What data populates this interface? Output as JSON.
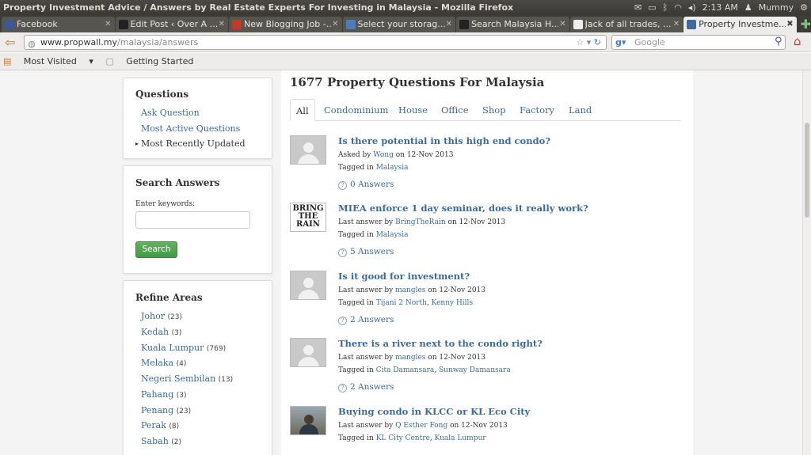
{
  "window_title": "Property Investment Advice / Answers by Real Estate Experts For Investing in Malaysia - Mozilla Firefox",
  "system_tray": {
    "time": "2:13 AM",
    "user": "Mummy"
  },
  "tabs": [
    {
      "label": "Facebook",
      "color": "#3b5998"
    },
    {
      "label": "Edit Post ‹ Over A ...",
      "color": "#222"
    },
    {
      "label": "New Blogging Job -...",
      "color": "#c0392b"
    },
    {
      "label": "Select your storag...",
      "color": "#4a7bbf"
    },
    {
      "label": "Search Malaysia H...",
      "color": "#222"
    },
    {
      "label": "Jack of all trades, ...",
      "color": "#eee"
    },
    {
      "label": "Property Investme...",
      "color": "#3b6aa0"
    }
  ],
  "url": {
    "domain": "www.propwall.my",
    "path": "/malaysia/answers"
  },
  "search_placeholder": "Google",
  "bookmarks": [
    "Most Visited",
    "Getting Started"
  ],
  "sidebar": {
    "questions_title": "Questions",
    "questions_links": [
      "Ask Question",
      "Most Active Questions",
      "Most Recently Updated"
    ],
    "search_title": "Search Answers",
    "keywords_label": "Enter keywords:",
    "search_button": "Search",
    "refine_title": "Refine Areas",
    "areas": [
      {
        "name": "Johor",
        "count": "(23)"
      },
      {
        "name": "Kedah",
        "count": "(3)"
      },
      {
        "name": "Kuala Lumpur",
        "count": "(769)"
      },
      {
        "name": "Melaka",
        "count": "(4)"
      },
      {
        "name": "Negeri Sembilan",
        "count": "(13)"
      },
      {
        "name": "Pahang",
        "count": "(3)"
      },
      {
        "name": "Penang",
        "count": "(23)"
      },
      {
        "name": "Perak",
        "count": "(8)"
      },
      {
        "name": "Sabah",
        "count": "(2)"
      }
    ]
  },
  "main": {
    "heading": "1677 Property Questions For Malaysia",
    "tabs": [
      "All",
      "Condominium",
      "House",
      "Office",
      "Shop",
      "Factory",
      "Land"
    ],
    "questions": [
      {
        "title": "Is there potential in this high end condo?",
        "by_label": "Asked by",
        "user": "Wong",
        "date": "on 12-Nov 2013",
        "tagged_label": "Tagged in",
        "tags": [
          "Malaysia"
        ],
        "answers": "0 Answers"
      },
      {
        "title": "MIEA enforce 1 day seminar, does it really work?",
        "by_label": "Last answer by",
        "user": "BringTheRain",
        "date": "on 12-Nov 2013",
        "tagged_label": "Tagged in",
        "tags": [
          "Malaysia"
        ],
        "answers": "5 Answers"
      },
      {
        "title": "Is it good for investment?",
        "by_label": "Last answer by",
        "user": "mangles",
        "date": "on 12-Nov 2013",
        "tagged_label": "Tagged in",
        "tags": [
          "Tijani 2 North",
          "Kenny Hills"
        ],
        "answers": "2 Answers"
      },
      {
        "title": "There is a river next to the condo right?",
        "by_label": "Last answer by",
        "user": "mangles",
        "date": "on 12-Nov 2013",
        "tagged_label": "Tagged in",
        "tags": [
          "Cita Damansara",
          "Sunway Damansara"
        ],
        "answers": "2 Answers"
      },
      {
        "title": "Buying condo in KLCC or KL Eco City",
        "by_label": "Last answer by",
        "user": "Q Esther Fong",
        "date": "on 12-Nov 2013",
        "tagged_label": "Tagged in",
        "tags": [
          "KL City Centre",
          "Kuala Lumpur"
        ],
        "answers": ""
      }
    ],
    "avatar_rain_text": "BRING THE RAIN"
  }
}
